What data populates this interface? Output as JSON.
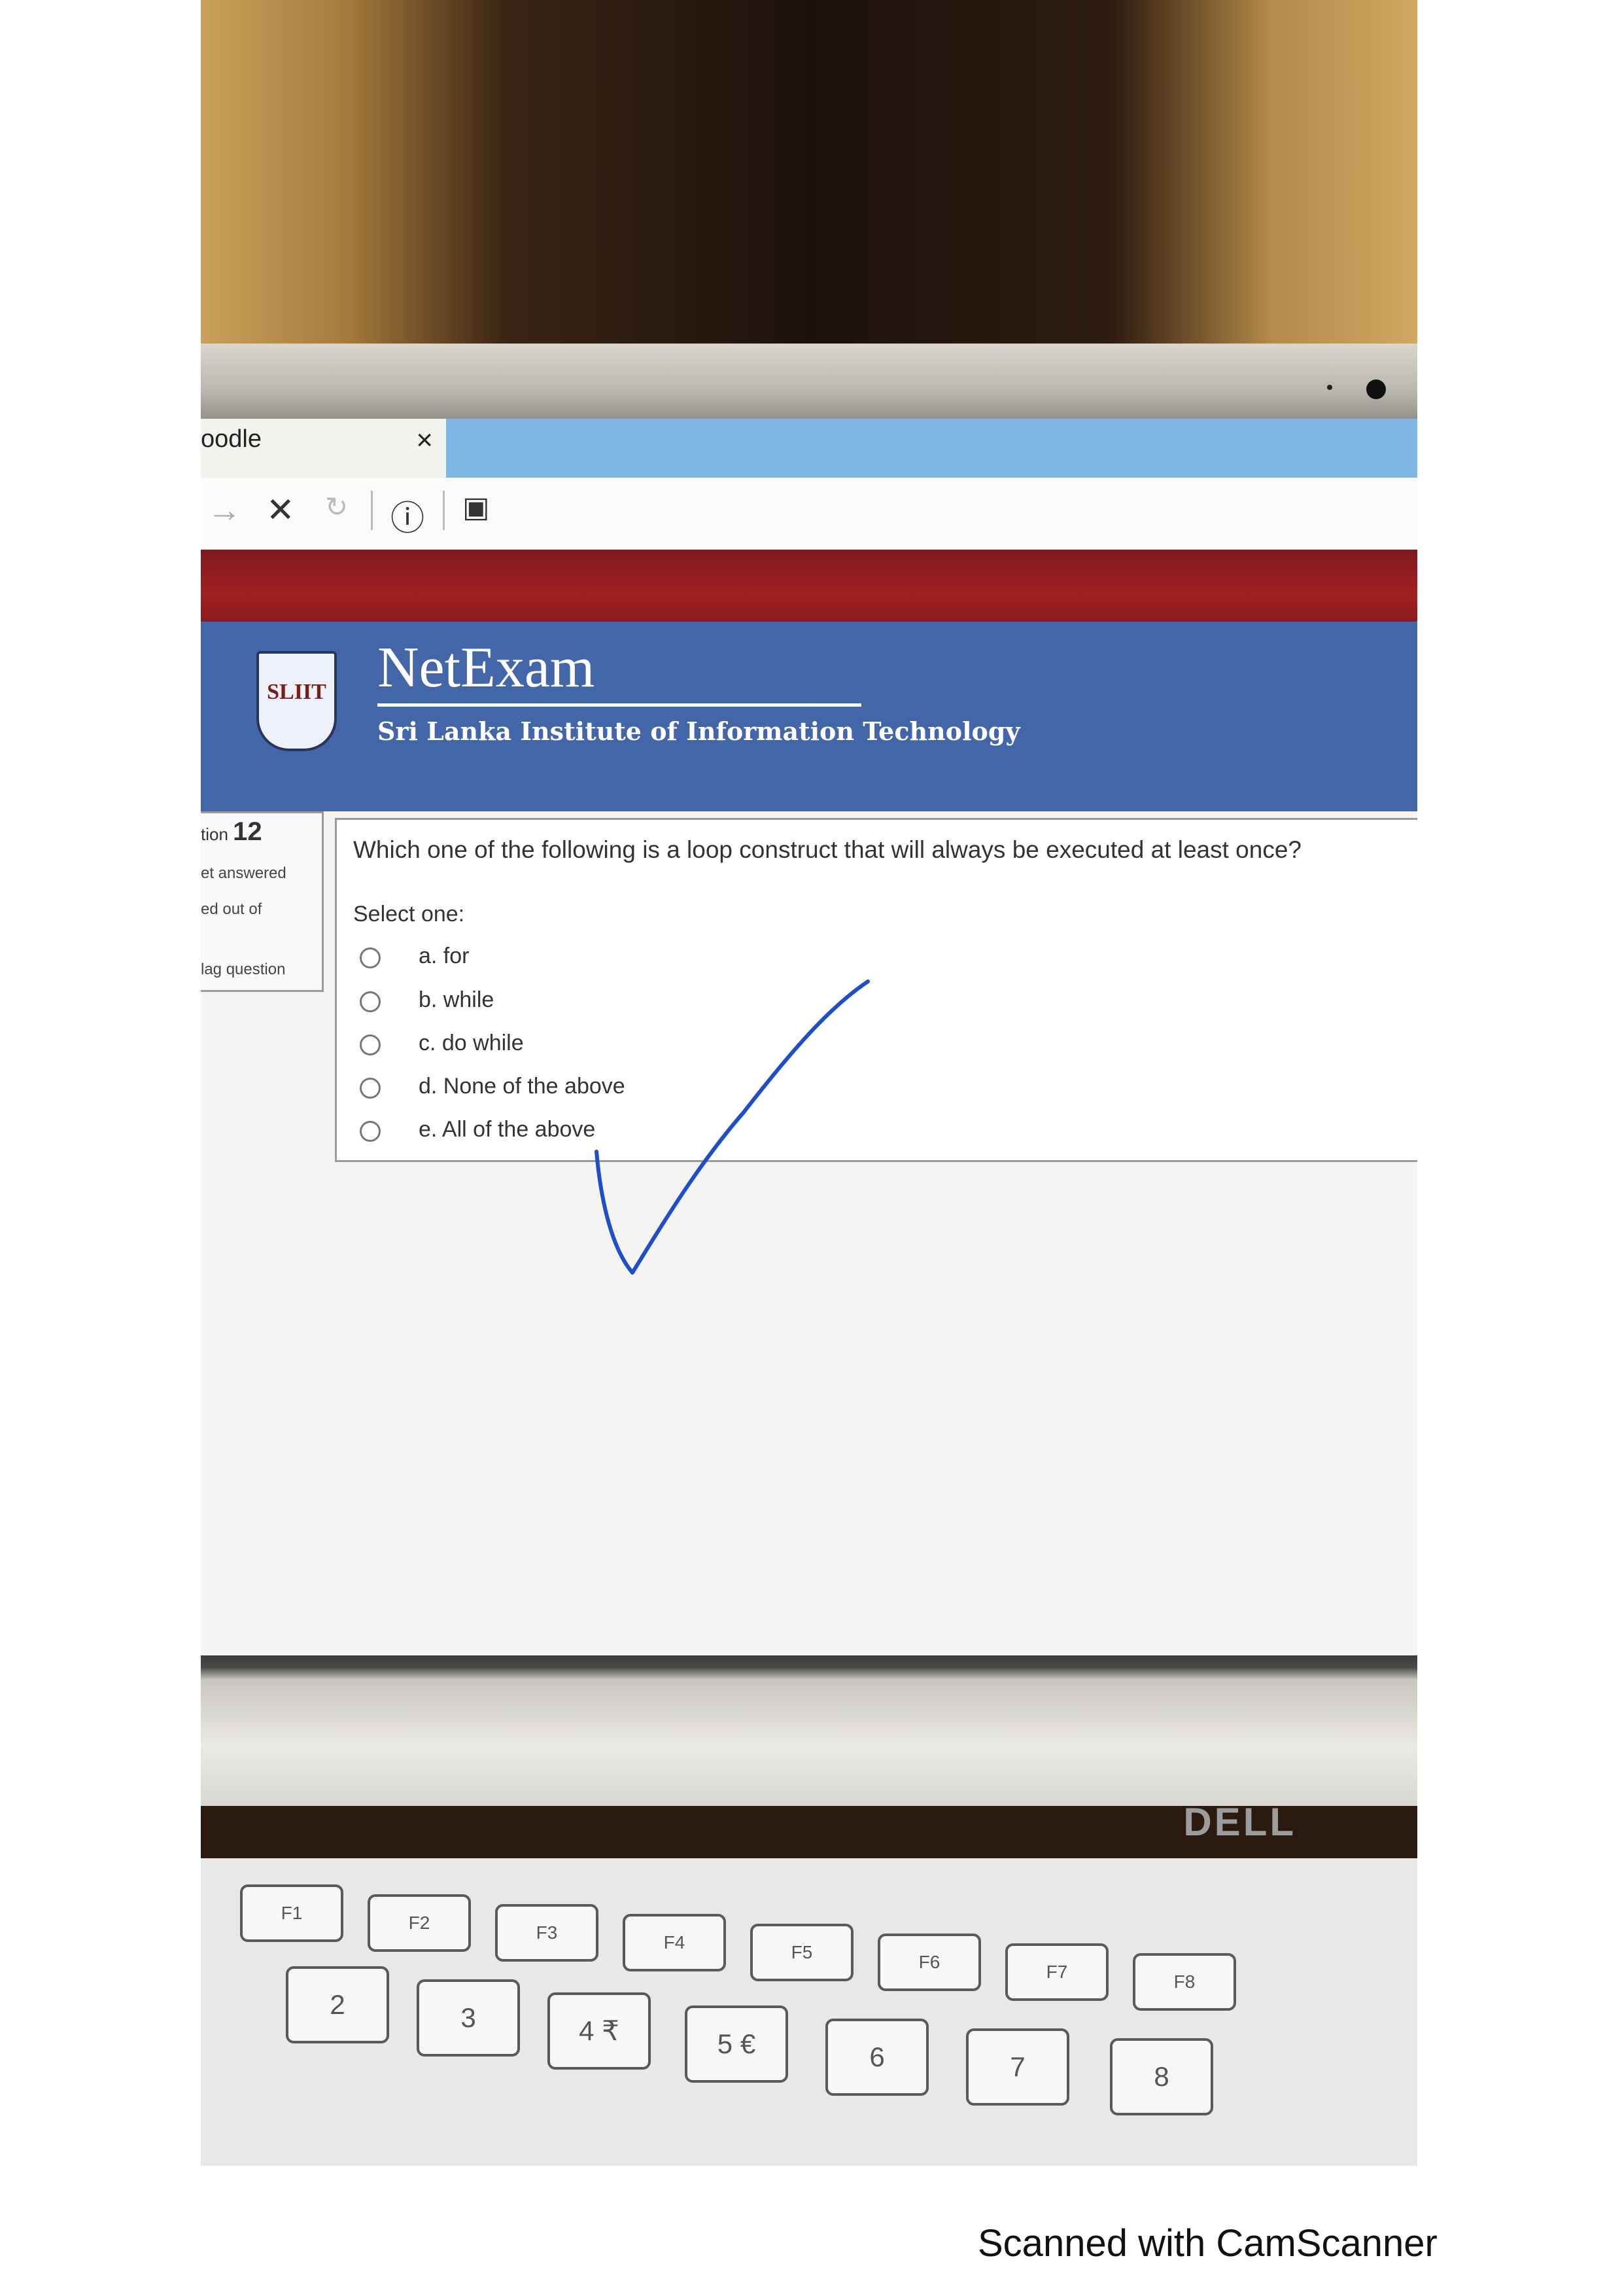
{
  "browser": {
    "tab_title": "oodle",
    "tab_close": "×",
    "nav": {
      "forward_icon": "→",
      "stop_icon": "✕",
      "reload_icon": "↻",
      "info_icon": "ⓘ",
      "reader_icon": "▣"
    }
  },
  "header": {
    "logo_text": "SLIIT",
    "brand": "NetExam",
    "subtitle": "Sri Lanka Institute of Information Technology"
  },
  "question_info": {
    "number_prefix": "tion",
    "number": "12",
    "status": "et answered",
    "marked": "ed out of",
    "flag": "lag question"
  },
  "question": {
    "text": "Which one of the following is a loop construct that will always be executed at least once?",
    "prompt": "Select one:",
    "answers": [
      {
        "label": "a. for",
        "selected": false
      },
      {
        "label": "b. while",
        "selected": false
      },
      {
        "label": "c. do while",
        "selected": false
      },
      {
        "label": "d. None of the above",
        "selected": false
      },
      {
        "label": "e. All of the above",
        "selected": false
      }
    ]
  },
  "annotation": {
    "icon": "checkmark-icon",
    "color": "#1f4fc8"
  },
  "laptop": {
    "brand": "DELL",
    "keys": [
      "2",
      "3",
      "4 ₹",
      "5 €",
      "6",
      "7",
      "8"
    ],
    "fn_keys": [
      "F1",
      "F2",
      "F3",
      "F4",
      "F5",
      "F6",
      "F7",
      "F8"
    ]
  },
  "footer": {
    "scanner_text": "Scanned with CamScanner"
  }
}
